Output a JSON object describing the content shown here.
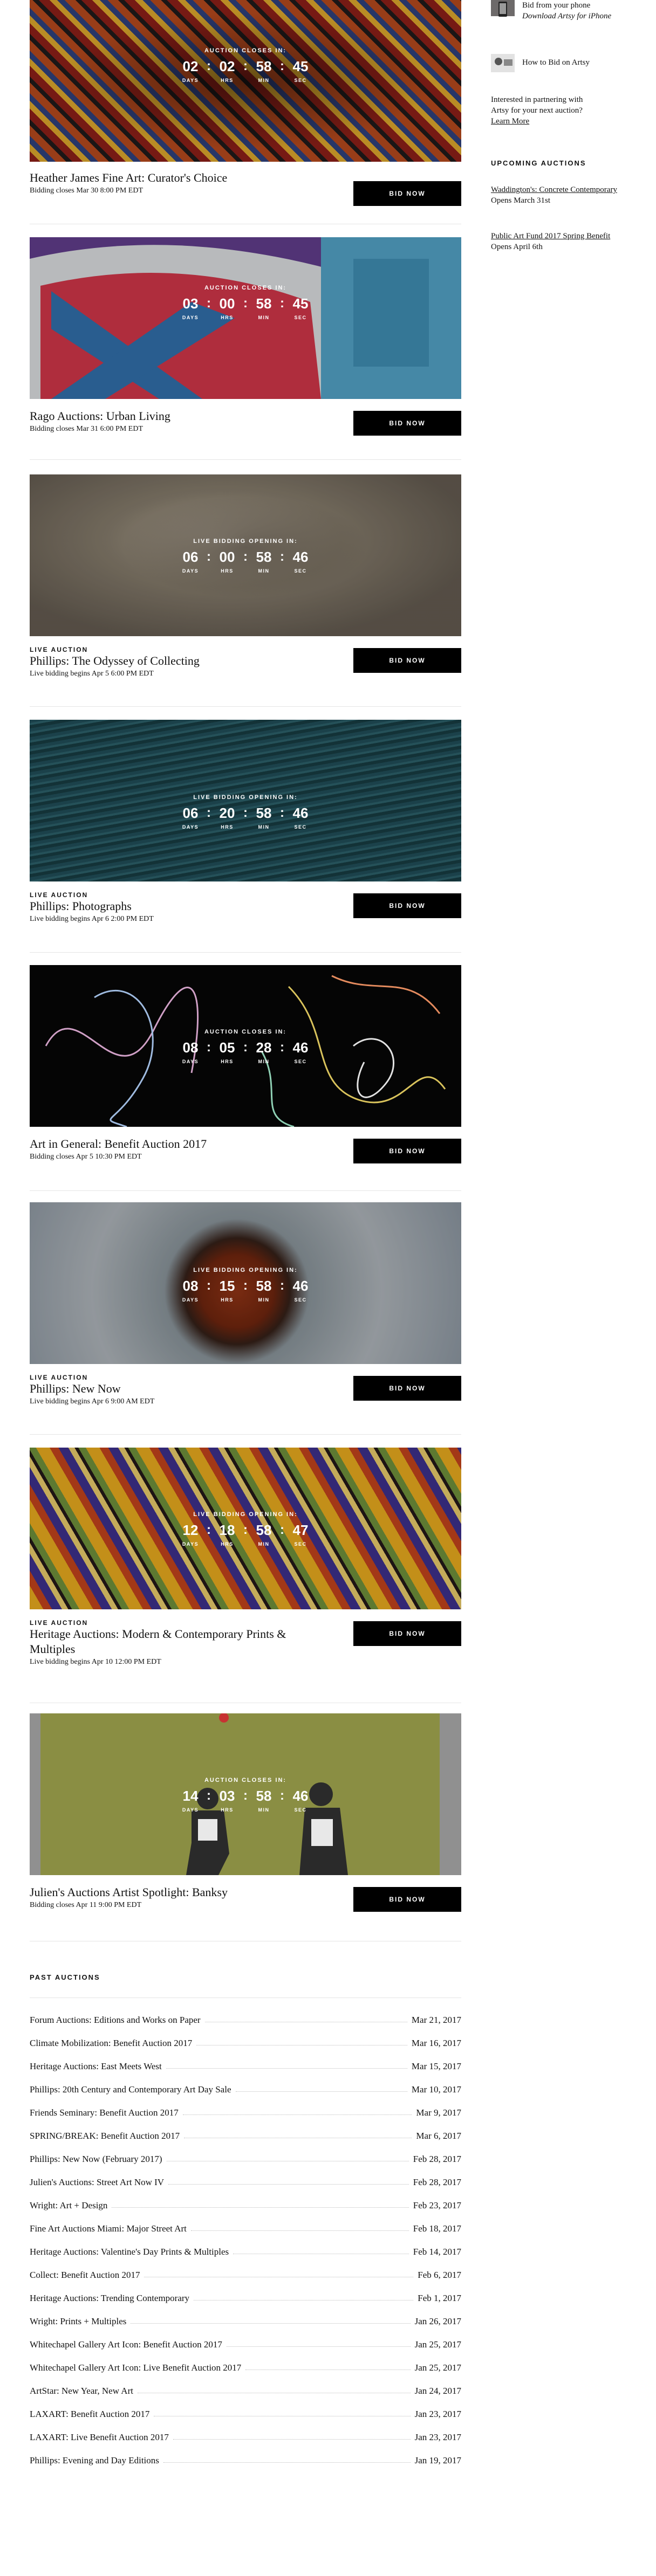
{
  "sidebar": {
    "download_title": "Bid from your phone",
    "download_sub": "Download Artsy for iPhone",
    "howto": "How to Bid on Artsy",
    "partner_text": "Interested in partnering with Artsy for your next auction?",
    "learn_more": "Learn More",
    "upcoming_heading": "UPCOMING AUCTIONS",
    "upcoming": [
      {
        "name": "Waddington's: Concrete Contemporary",
        "date": "Opens March 31st"
      },
      {
        "name": "Public Art Fund 2017 Spring Benefit",
        "date": "Opens April 6th"
      }
    ]
  },
  "countdown_labels": {
    "days": "DAYS",
    "hrs": "HRS",
    "min": "MIN",
    "sec": "SEC"
  },
  "bid_label": "BID NOW",
  "auctions": [
    {
      "kicker": "",
      "title": "Heather James Fine Art: Curator's Choice",
      "closes": "Bidding closes Mar 30 8:00 PM EDT",
      "caption": "AUCTION CLOSES IN:",
      "d": "02",
      "h": "02",
      "m": "58",
      "s": "45"
    },
    {
      "kicker": "",
      "title": "Rago Auctions: Urban Living",
      "closes": "Bidding closes Mar 31 6:00 PM EDT",
      "caption": "AUCTION CLOSES IN:",
      "d": "03",
      "h": "00",
      "m": "58",
      "s": "45"
    },
    {
      "kicker": "LIVE AUCTION",
      "title": "Phillips: The Odyssey of Collecting",
      "closes": "Live bidding begins Apr 5 6:00 PM EDT",
      "caption": "LIVE BIDDING OPENING IN:",
      "d": "06",
      "h": "00",
      "m": "58",
      "s": "46"
    },
    {
      "kicker": "LIVE AUCTION",
      "title": "Phillips: Photographs",
      "closes": "Live bidding begins Apr 6 2:00 PM EDT",
      "caption": "LIVE BIDDING OPENING IN:",
      "d": "06",
      "h": "20",
      "m": "58",
      "s": "46"
    },
    {
      "kicker": "",
      "title": "Art in General: Benefit Auction 2017",
      "closes": "Bidding closes Apr 5 10:30 PM EDT",
      "caption": "AUCTION CLOSES IN:",
      "d": "08",
      "h": "05",
      "m": "28",
      "s": "46"
    },
    {
      "kicker": "LIVE AUCTION",
      "title": "Phillips: New Now",
      "closes": "Live bidding begins Apr 6 9:00 AM EDT",
      "caption": "LIVE BIDDING OPENING IN:",
      "d": "08",
      "h": "15",
      "m": "58",
      "s": "46"
    },
    {
      "kicker": "LIVE AUCTION",
      "title": "Heritage Auctions: Modern & Contemporary Prints & Multiples",
      "closes": "Live bidding begins Apr 10 12:00 PM EDT",
      "caption": "LIVE BIDDING OPENING IN:",
      "d": "12",
      "h": "18",
      "m": "58",
      "s": "47"
    },
    {
      "kicker": "",
      "title": "Julien's Auctions Artist Spotlight: Banksy",
      "closes": "Bidding closes Apr 11 9:00 PM EDT",
      "caption": "AUCTION CLOSES IN:",
      "d": "14",
      "h": "03",
      "m": "58",
      "s": "46"
    }
  ],
  "past_heading": "PAST AUCTIONS",
  "past": [
    {
      "name": "Forum Auctions: Editions and Works on Paper",
      "date": "Mar 21, 2017"
    },
    {
      "name": "Climate Mobilization: Benefit Auction 2017",
      "date": "Mar 16, 2017"
    },
    {
      "name": "Heritage Auctions: East Meets West",
      "date": "Mar 15, 2017"
    },
    {
      "name": "Phillips: 20th Century and Contemporary Art Day Sale",
      "date": "Mar 10, 2017"
    },
    {
      "name": "Friends Seminary: Benefit Auction 2017",
      "date": "Mar 9, 2017"
    },
    {
      "name": "SPRING/BREAK: Benefit Auction 2017",
      "date": "Mar 6, 2017"
    },
    {
      "name": "Phillips: New Now (February 2017)",
      "date": "Feb 28, 2017"
    },
    {
      "name": "Julien's Auctions: Street Art Now IV",
      "date": "Feb 28, 2017"
    },
    {
      "name": "Wright: Art + Design",
      "date": "Feb 23, 2017"
    },
    {
      "name": "Fine Art Auctions Miami: Major Street Art",
      "date": "Feb 18, 2017"
    },
    {
      "name": "Heritage Auctions: Valentine's Day Prints & Multiples",
      "date": "Feb 14, 2017"
    },
    {
      "name": "Collect: Benefit Auction 2017",
      "date": "Feb 6, 2017"
    },
    {
      "name": "Heritage Auctions: Trending Contemporary",
      "date": "Feb 1, 2017"
    },
    {
      "name": "Wright: Prints + Multiples",
      "date": "Jan 26, 2017"
    },
    {
      "name": "Whitechapel Gallery Art Icon: Benefit Auction 2017",
      "date": "Jan 25, 2017"
    },
    {
      "name": "Whitechapel Gallery Art Icon: Live Benefit Auction 2017",
      "date": "Jan 25, 2017"
    },
    {
      "name": "ArtStar: New Year, New Art",
      "date": "Jan 24, 2017"
    },
    {
      "name": "LAXART: Benefit Auction 2017",
      "date": "Jan 23, 2017"
    },
    {
      "name": "LAXART: Live Benefit Auction 2017",
      "date": "Jan 23, 2017"
    },
    {
      "name": "Phillips: Evening and Day Editions",
      "date": "Jan 19, 2017"
    }
  ]
}
